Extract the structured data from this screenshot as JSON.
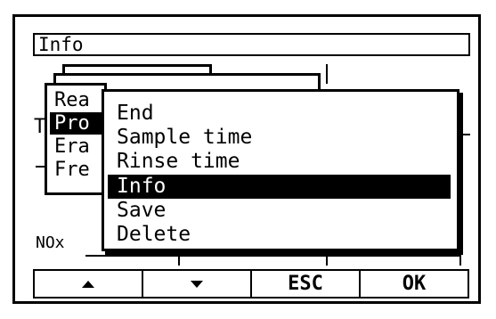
{
  "window": {
    "title": "Info"
  },
  "background": {
    "nox_label": "NOx",
    "partial_label": "T"
  },
  "submenu_parent": {
    "items": [
      {
        "label": "Rea",
        "selected": false
      },
      {
        "label": "Pro",
        "selected": true
      },
      {
        "label": "Era",
        "selected": false
      },
      {
        "label": "Fre",
        "selected": false
      }
    ]
  },
  "menu": {
    "items": [
      {
        "label": "End",
        "selected": false
      },
      {
        "label": "Sample time",
        "selected": false
      },
      {
        "label": "Rinse time",
        "selected": false
      },
      {
        "label": "Info",
        "selected": true
      },
      {
        "label": "Save",
        "selected": false
      },
      {
        "label": "Delete",
        "selected": false
      }
    ]
  },
  "softkeys": {
    "up_icon": "triangle-up-icon",
    "down_icon": "triangle-down-icon",
    "esc_label": "ESC",
    "ok_label": "OK"
  }
}
